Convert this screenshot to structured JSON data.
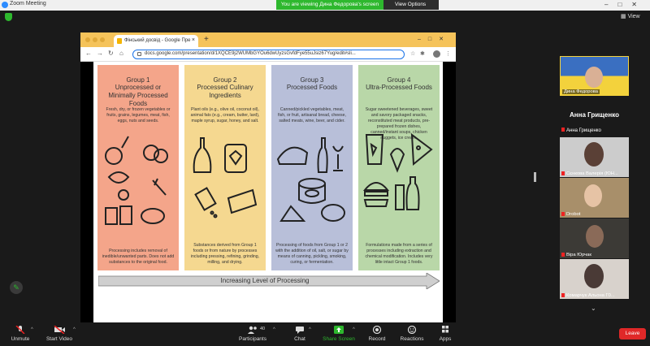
{
  "window": {
    "title": "Zoom Meeting"
  },
  "banner": {
    "viewing_text": "You are viewing Дина Федорова's screen",
    "view_options": "View Options"
  },
  "gallery": {
    "view_label": "View"
  },
  "browser": {
    "tab_title": "Фінський досвід - Google Пре",
    "url": "docs.google.com/presentation/d/1XQCE9j2WUMbGYOu6dwUyzsGvfdFye55uJsiz67Yug/edit#sli..."
  },
  "slide": {
    "groups": [
      {
        "name": "Group 1",
        "title": "Unprocessed or Minimally Processed Foods",
        "desc": "Fresh, dry, or frozen vegetables or fruits, grains, legumes, meat, fish, eggs, nuts and seeds.",
        "footer": "Processing includes removal of inedible/unwanted parts. Does not add substances to the original food.",
        "color": "#f4a58a"
      },
      {
        "name": "Group 2",
        "title": "Processed Culinary Ingredients",
        "desc": "Plant oils (e.g., olive oil, coconut oil), animal fats (e.g., cream, butter, lard), maple syrup, sugar, honey, and salt.",
        "footer": "Substances derived from Group 1 foods or from nature by processes including pressing, refining, grinding, milling, and drying.",
        "color": "#f5d890"
      },
      {
        "name": "Group 3",
        "title": "Processed Foods",
        "desc": "Canned/pickled vegetables, meat, fish, or fruit, artisanal bread, cheese, salted meats, wine, beer, and cider.",
        "footer": "Processing of foods from Group 1 or 2 with the addition of oil, salt, or sugar by means of canning, pickling, smoking, curing, or fermentation.",
        "color": "#b8bfd9"
      },
      {
        "name": "Group 4",
        "title": "Ultra-Processed Foods",
        "desc": "Sugar sweetened beverages, sweet and savory packaged snacks, reconstituted meat products, pre-prepared frozen dishes, canned/instant soups, chicken nuggets, ice cream.",
        "footer": "Formulations made from a series of processes including extraction and chemical modification. Includes very little intact Group 1 foods.",
        "color": "#b9d7a8"
      }
    ],
    "arrow_label": "Increasing Level of Processing"
  },
  "participants": {
    "active": {
      "name": "Дина Федорова"
    },
    "anna_big": "Анна Грищенко",
    "anna_small": "Анна Грищенко",
    "others": [
      {
        "name": "Сєнкова Валерія (ЮН..."
      },
      {
        "name": "Drobot"
      },
      {
        "name": "Віра Юрчак"
      },
      {
        "name": "Комарчук Альона Г0..."
      }
    ]
  },
  "toolbar": {
    "unmute": "Unmute",
    "start_video": "Start Video",
    "participants": "Participants",
    "participants_count": "40",
    "chat": "Chat",
    "share_screen": "Share Screen",
    "record": "Record",
    "reactions": "Reactions",
    "apps": "Apps",
    "leave": "Leave"
  }
}
